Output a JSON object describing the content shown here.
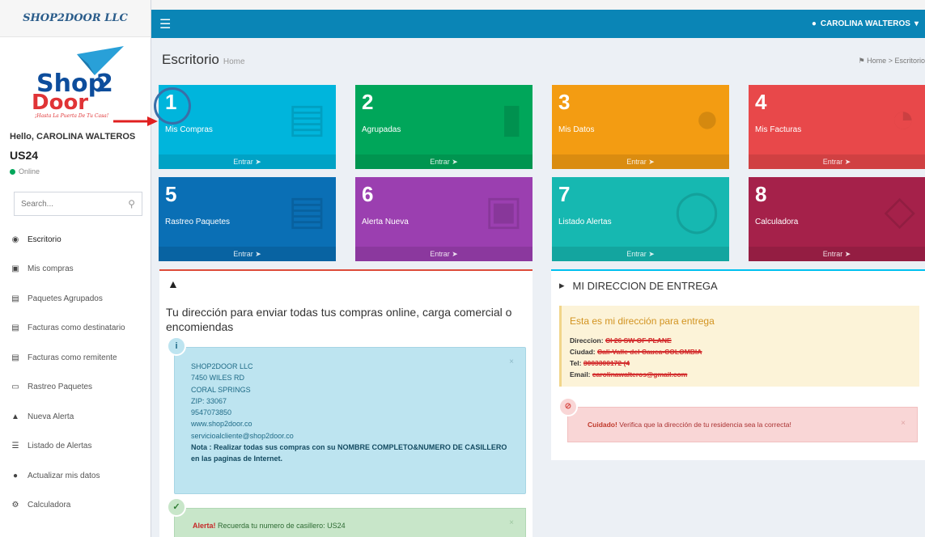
{
  "brand": "SHOP2DOOR LLC",
  "logo_text": "Shop2Door",
  "logo_tagline": "¡Hasta La Puerta De Tu Casa!",
  "user": {
    "greeting": "Hello, CAROLINA WALTEROS",
    "code": "US24",
    "status": "Online",
    "menu_label": "CAROLINA WALTEROS"
  },
  "search": {
    "placeholder": "Search..."
  },
  "menu": [
    {
      "label": "Escritorio",
      "icon": "dashboard-icon"
    },
    {
      "label": "Mis compras",
      "icon": "shopping-icon"
    },
    {
      "label": "Paquetes Agrupados",
      "icon": "truck-icon"
    },
    {
      "label": "Facturas como destinatario",
      "icon": "invoice-icon"
    },
    {
      "label": "Facturas como remitente",
      "icon": "invoice-icon"
    },
    {
      "label": "Rastreo Paquetes",
      "icon": "laptop-icon"
    },
    {
      "label": "Nueva Alerta",
      "icon": "bell-icon"
    },
    {
      "label": "Listado de Alertas",
      "icon": "list-icon"
    },
    {
      "label": "Actualizar mis datos",
      "icon": "user-icon"
    },
    {
      "label": "Calculadora",
      "icon": "gear-icon"
    }
  ],
  "header": {
    "title": "Escritorio",
    "subtitle": "Home",
    "breadcrumb_home": "Home",
    "breadcrumb_current": "Escritorio"
  },
  "tiles": [
    {
      "num": "1",
      "label": "Mis Compras",
      "link": "Entrar",
      "color": "#00b5dc"
    },
    {
      "num": "2",
      "label": "Agrupadas",
      "link": "Entrar",
      "color": "#00a65a"
    },
    {
      "num": "3",
      "label": "Mis Datos",
      "link": "Entrar",
      "color": "#f39c12"
    },
    {
      "num": "4",
      "label": "Mis Facturas",
      "link": "Entrar",
      "color": "#e8484a"
    },
    {
      "num": "5",
      "label": "Rastreo Paquetes",
      "link": "Entrar",
      "color": "#0a6fb5"
    },
    {
      "num": "6",
      "label": "Alerta Nueva",
      "link": "Entrar",
      "color": "#9b3fb0"
    },
    {
      "num": "7",
      "label": "Listado Alertas",
      "link": "Entrar",
      "color": "#16b8b1"
    },
    {
      "num": "8",
      "label": "Calculadora",
      "link": "Entrar",
      "color": "#a5214a"
    }
  ],
  "address_box": {
    "lead": "Tu dirección para enviar todas tus compras online, carga comercial o encomiendas",
    "lines": [
      "SHOP2DOOR LLC",
      "7450 WILES RD",
      "CORAL SPRINGS",
      "ZIP: 33067",
      "9547073850",
      "www.shop2door.co",
      "servicioalcliente@shop2door.co"
    ],
    "note": "Nota : Realizar todas sus compras con su NOMBRE COMPLETO&NUMERO DE CASILLERO en las paginas de Internet.",
    "alert_label": "Alerta!",
    "alert_text": "Recuerda tu numero de casillero: US24"
  },
  "delivery": {
    "title": "MI DIRECCION DE ENTREGA",
    "heading": "Esta es mi dirección para entrega",
    "direccion_label": "Direccion:",
    "direccion_value": "Cl 26 SW OF PLANE",
    "ciudad_label": "Ciudad:",
    "ciudad_value": "Cali-Valle del Cauca-COLOMBIA",
    "tel_label": "Tel:",
    "tel_value": "3003300172 (4",
    "email_label": "Email:",
    "email_value": "carolinawalteros@gmail.com",
    "warning_label": "Cuidado!",
    "warning_text": "Verifica que la dirección de tu residencia sea la correcta!"
  }
}
